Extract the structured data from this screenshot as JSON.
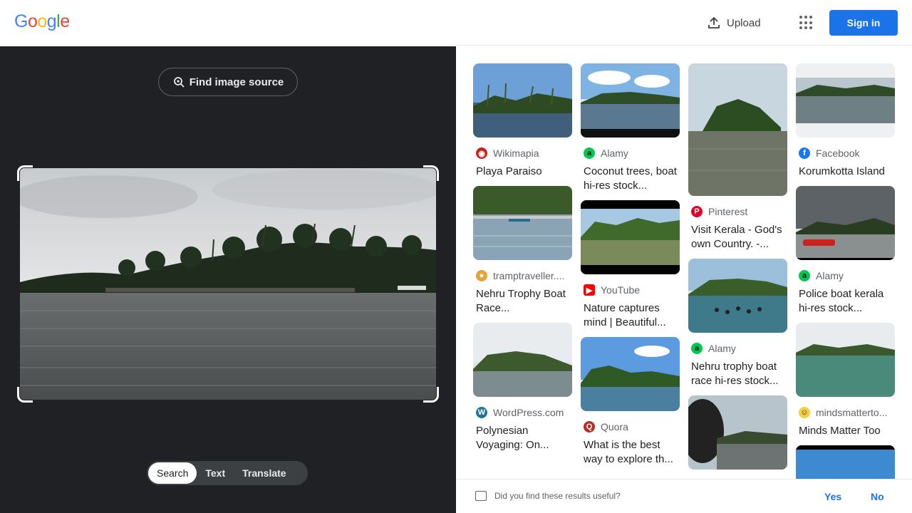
{
  "header": {
    "logo_letters": [
      "G",
      "o",
      "o",
      "g",
      "l",
      "e"
    ],
    "upload_label": "Upload",
    "signin_label": "Sign in"
  },
  "lens": {
    "find_source_label": "Find image source",
    "modes": [
      "Search",
      "Text",
      "Translate"
    ],
    "active_mode": "Search"
  },
  "results": {
    "col1": [
      {
        "source": "Wikimapia",
        "title": "Playa Paraiso",
        "icon": "wikimapia-icon",
        "icon_color": "#c5221f"
      },
      {
        "source": "tramptraveller....",
        "title": "Nehru Trophy Boat Race...",
        "icon": "tramptraveller-icon",
        "icon_color": "#e6a33b"
      },
      {
        "source": "WordPress.com",
        "title": "Polynesian Voyaging: On...",
        "icon": "wordpress-icon",
        "icon_color": "#21759b"
      }
    ],
    "col2": [
      {
        "source": "Alamy",
        "title": "Coconut trees, boat hi-res stock...",
        "icon": "alamy-icon",
        "icon_color": "#00c853"
      },
      {
        "source": "YouTube",
        "title": "Nature captures mind | Beautiful...",
        "icon": "youtube-icon",
        "icon_color": "#ff0000"
      },
      {
        "source": "Quora",
        "title": "What is the best way to explore th...",
        "icon": "quora-icon",
        "icon_color": "#b92b27"
      }
    ],
    "col3": [
      {
        "source": "Pinterest",
        "title": "Visit Kerala - God's own Country. -...",
        "icon": "pinterest-icon",
        "icon_color": "#e60023"
      },
      {
        "source": "Alamy",
        "title": "Nehru trophy boat race hi-res stock...",
        "icon": "alamy-icon",
        "icon_color": "#00c853"
      }
    ],
    "col4": [
      {
        "source": "Facebook",
        "title": "Korumkotta Island",
        "icon": "facebook-icon",
        "icon_color": "#1877f2"
      },
      {
        "source": "Alamy",
        "title": "Police boat kerala hi-res stock...",
        "icon": "alamy-icon",
        "icon_color": "#00c853"
      },
      {
        "source": "mindsmatterto...",
        "title": "Minds Matter Too",
        "icon": "mindsmatter-icon",
        "icon_color": "#f4d03f"
      }
    ]
  },
  "feedback": {
    "question": "Did you find these results useful?",
    "yes_label": "Yes",
    "no_label": "No"
  },
  "colors": {
    "accent": "#1a73e8",
    "dark_panel": "#202124"
  }
}
